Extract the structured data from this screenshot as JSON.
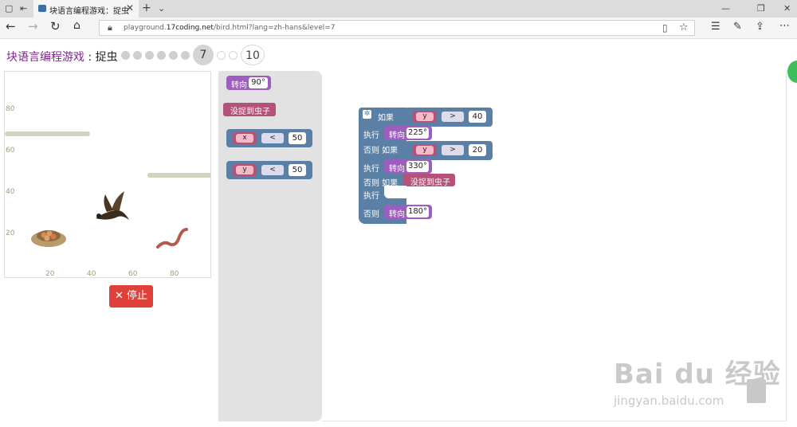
{
  "browser": {
    "tab_title": "块语言编程游戏：捉虫",
    "url_prefix": "playground.",
    "url_domain": "17coding.net",
    "url_path": "/bird.html?lang=zh-hans&level=7"
  },
  "header": {
    "title": "块语言编程游戏",
    "separator": " : ",
    "subtitle": "捉虫",
    "current_level": "7",
    "max_level": "10"
  },
  "game": {
    "y_ticks": [
      "80",
      "60",
      "40",
      "20"
    ],
    "x_ticks": [
      "20",
      "40",
      "60",
      "80"
    ],
    "stop_label": "停止"
  },
  "toolbox": {
    "turn_label": "转向",
    "turn_value": "90°",
    "no_worm_label": "没捉到虫子",
    "cmp1_var": "x",
    "cmp1_op": "<",
    "cmp1_val": "50",
    "cmp2_var": "y",
    "cmp2_op": "<",
    "cmp2_val": "50"
  },
  "workspace": {
    "if_label": "如果",
    "do_label": "执行",
    "elseif_label": "否则 如果",
    "else_label": "否则",
    "turn_label": "转向",
    "cond1_var": "y",
    "cond1_op": ">",
    "cond1_val": "40",
    "turn1": "225°",
    "cond2_var": "y",
    "cond2_op": ">",
    "cond2_val": "20",
    "turn2": "330°",
    "cond3": "没捉到虫子",
    "turn3": "180°"
  },
  "watermark": {
    "logo": "Bai du 经验",
    "url": "jingyan.baidu.com"
  },
  "colors": {
    "title_purple": "#7b2a8a",
    "stop_red": "#e0403a",
    "block_purple": "#9e5ebf",
    "block_pink": "#b5527a",
    "block_blue": "#5b80a5"
  }
}
